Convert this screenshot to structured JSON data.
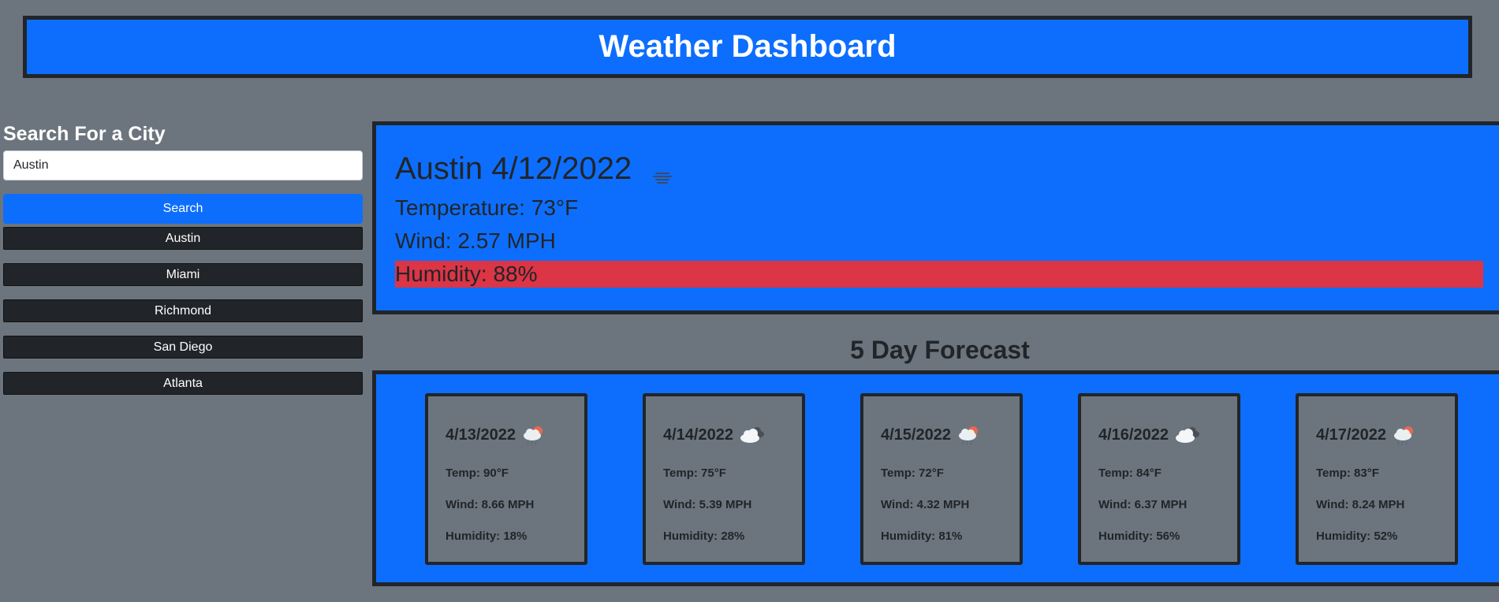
{
  "header": {
    "title": "Weather Dashboard"
  },
  "search": {
    "title": "Search For a City",
    "input_value": "Austin",
    "button_label": "Search"
  },
  "history": [
    "Austin",
    "Miami",
    "Richmond",
    "San Diego",
    "Atlanta"
  ],
  "current": {
    "title": "Austin 4/12/2022",
    "icon": "mist-icon",
    "temperature": "Temperature: 73°F",
    "wind": "Wind: 2.57 MPH",
    "humidity": "Humidity: 88%"
  },
  "forecast": {
    "heading": "5 Day Forecast",
    "days": [
      {
        "date": "4/13/2022",
        "icon": "sun-cloud-rain-icon",
        "temp": "Temp: 90°F",
        "wind": "Wind: 8.66 MPH",
        "humidity": "Humidity: 18%"
      },
      {
        "date": "4/14/2022",
        "icon": "clouds-icon",
        "temp": "Temp: 75°F",
        "wind": "Wind: 5.39 MPH",
        "humidity": "Humidity: 28%"
      },
      {
        "date": "4/15/2022",
        "icon": "sun-cloud-rain-icon",
        "temp": "Temp: 72°F",
        "wind": "Wind: 4.32 MPH",
        "humidity": "Humidity: 81%"
      },
      {
        "date": "4/16/2022",
        "icon": "clouds-icon",
        "temp": "Temp: 84°F",
        "wind": "Wind: 6.37 MPH",
        "humidity": "Humidity: 56%"
      },
      {
        "date": "4/17/2022",
        "icon": "sun-cloud-rain-icon",
        "temp": "Temp: 83°F",
        "wind": "Wind: 8.24 MPH",
        "humidity": "Humidity: 52%"
      }
    ]
  },
  "colors": {
    "primary": "#0d6efd",
    "background": "#6c757d",
    "dark": "#212529",
    "danger": "#dc3545"
  }
}
